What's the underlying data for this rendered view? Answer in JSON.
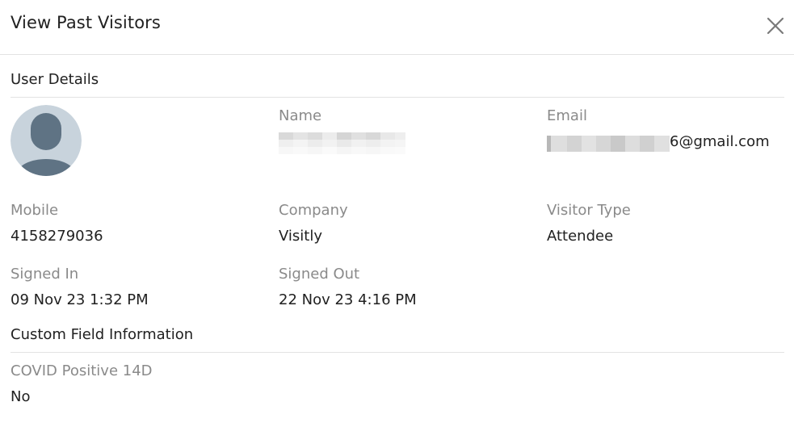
{
  "modal": {
    "title": "View Past Visitors",
    "close_icon": "close-icon"
  },
  "user_details": {
    "section_title": "User Details",
    "avatar_icon": "user-avatar-icon",
    "name": {
      "label": "Name",
      "value": ""
    },
    "email": {
      "label": "Email",
      "value": "6@gmail.com"
    },
    "mobile": {
      "label": "Mobile",
      "value": "4158279036"
    },
    "company": {
      "label": "Company",
      "value": "Visitly"
    },
    "visitor_type": {
      "label": "Visitor Type",
      "value": "Attendee"
    },
    "signed_in": {
      "label": "Signed In",
      "value": "09 Nov 23 1:32 PM"
    },
    "signed_out": {
      "label": "Signed Out",
      "value": "22 Nov 23 4:16 PM"
    }
  },
  "custom_fields": {
    "section_title": "Custom Field Information",
    "covid": {
      "label": "COVID Positive 14D",
      "value": "No"
    }
  },
  "colors": {
    "avatar_bg": "#c8d3dc",
    "avatar_fg": "#5f7384",
    "label": "#8a8a8a",
    "divider": "#e3e3e3"
  }
}
